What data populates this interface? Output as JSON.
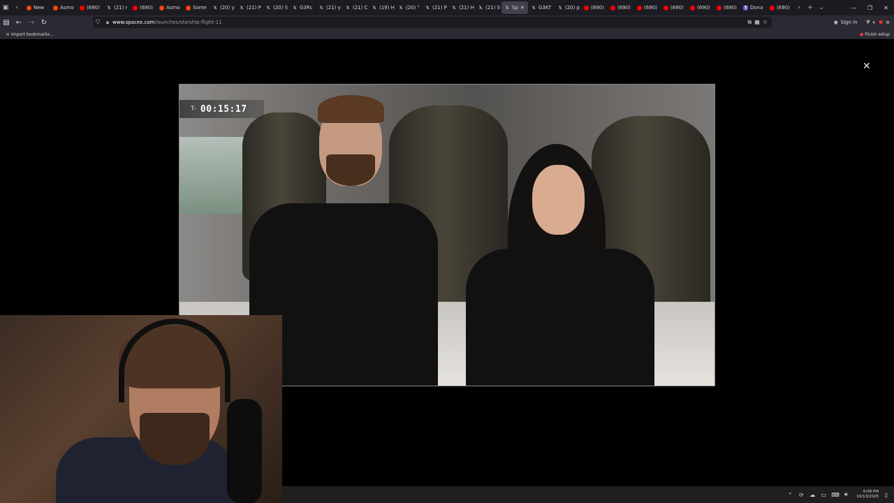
{
  "browser": {
    "tabs": [
      {
        "label": "New",
        "icon": "reddit-icon",
        "color": "#ff4500"
      },
      {
        "label": "Asmo",
        "icon": "reddit-icon",
        "color": "#ff4500"
      },
      {
        "label": "(690)",
        "icon": "youtube-icon",
        "color": "#ff0000"
      },
      {
        "label": "(21) r",
        "icon": "x-icon",
        "color": "#ffffff"
      },
      {
        "label": "(690)",
        "icon": "youtube-icon",
        "color": "#ff0000"
      },
      {
        "label": "Asmo",
        "icon": "reddit-icon",
        "color": "#ff4500"
      },
      {
        "label": "Some",
        "icon": "reddit-icon",
        "color": "#ff4500"
      },
      {
        "label": "(20) y",
        "icon": "x-icon",
        "color": "#ffffff"
      },
      {
        "label": "(21) P",
        "icon": "x-icon",
        "color": "#ffffff"
      },
      {
        "label": "(20) S",
        "icon": "x-icon",
        "color": "#ffffff"
      },
      {
        "label": "G3Rc",
        "icon": "x-icon",
        "color": "#ffffff"
      },
      {
        "label": "(21) y",
        "icon": "x-icon",
        "color": "#ffffff"
      },
      {
        "label": "(21) C",
        "icon": "x-icon",
        "color": "#ffffff"
      },
      {
        "label": "(19) H",
        "icon": "x-icon",
        "color": "#ffffff"
      },
      {
        "label": "(20) \"",
        "icon": "x-icon",
        "color": "#ffffff"
      },
      {
        "label": "(21) P",
        "icon": "x-icon",
        "color": "#ffffff"
      },
      {
        "label": "(21) H",
        "icon": "x-icon",
        "color": "#ffffff"
      },
      {
        "label": "(21) S",
        "icon": "x-icon",
        "color": "#ffffff"
      },
      {
        "label": "Sp",
        "icon": "x-icon",
        "color": "#ffffff",
        "active": true
      },
      {
        "label": "G3KT",
        "icon": "x-icon",
        "color": "#ffffff"
      },
      {
        "label": "(20) p",
        "icon": "x-icon",
        "color": "#ffffff"
      },
      {
        "label": "(690)",
        "icon": "youtube-icon",
        "color": "#ff0000"
      },
      {
        "label": "(690)",
        "icon": "youtube-icon",
        "color": "#ff0000"
      },
      {
        "label": "(690)",
        "icon": "youtube-icon",
        "color": "#ff0000"
      },
      {
        "label": "(690)",
        "icon": "youtube-icon",
        "color": "#ff0000"
      },
      {
        "label": "(690)",
        "icon": "youtube-icon",
        "color": "#ff0000"
      },
      {
        "label": "(690)",
        "icon": "youtube-icon",
        "color": "#ff0000"
      },
      {
        "label": "Dona",
        "icon": "t-icon",
        "color": "#5b5fc7"
      },
      {
        "label": "(690)",
        "icon": "youtube-icon",
        "color": "#ff0000"
      }
    ],
    "url_host": "www.spacex.com",
    "url_path": "/launches/starship-flight-11",
    "sign_in": "Sign in",
    "import_bookmarks": "Import bookmarks...",
    "finish_setup": "Finish setup"
  },
  "video": {
    "timer_prefix": "T-",
    "timer_value": "00:15:17"
  },
  "taskbar": {
    "time": "6:08 PM",
    "date": "10/13/2025"
  }
}
